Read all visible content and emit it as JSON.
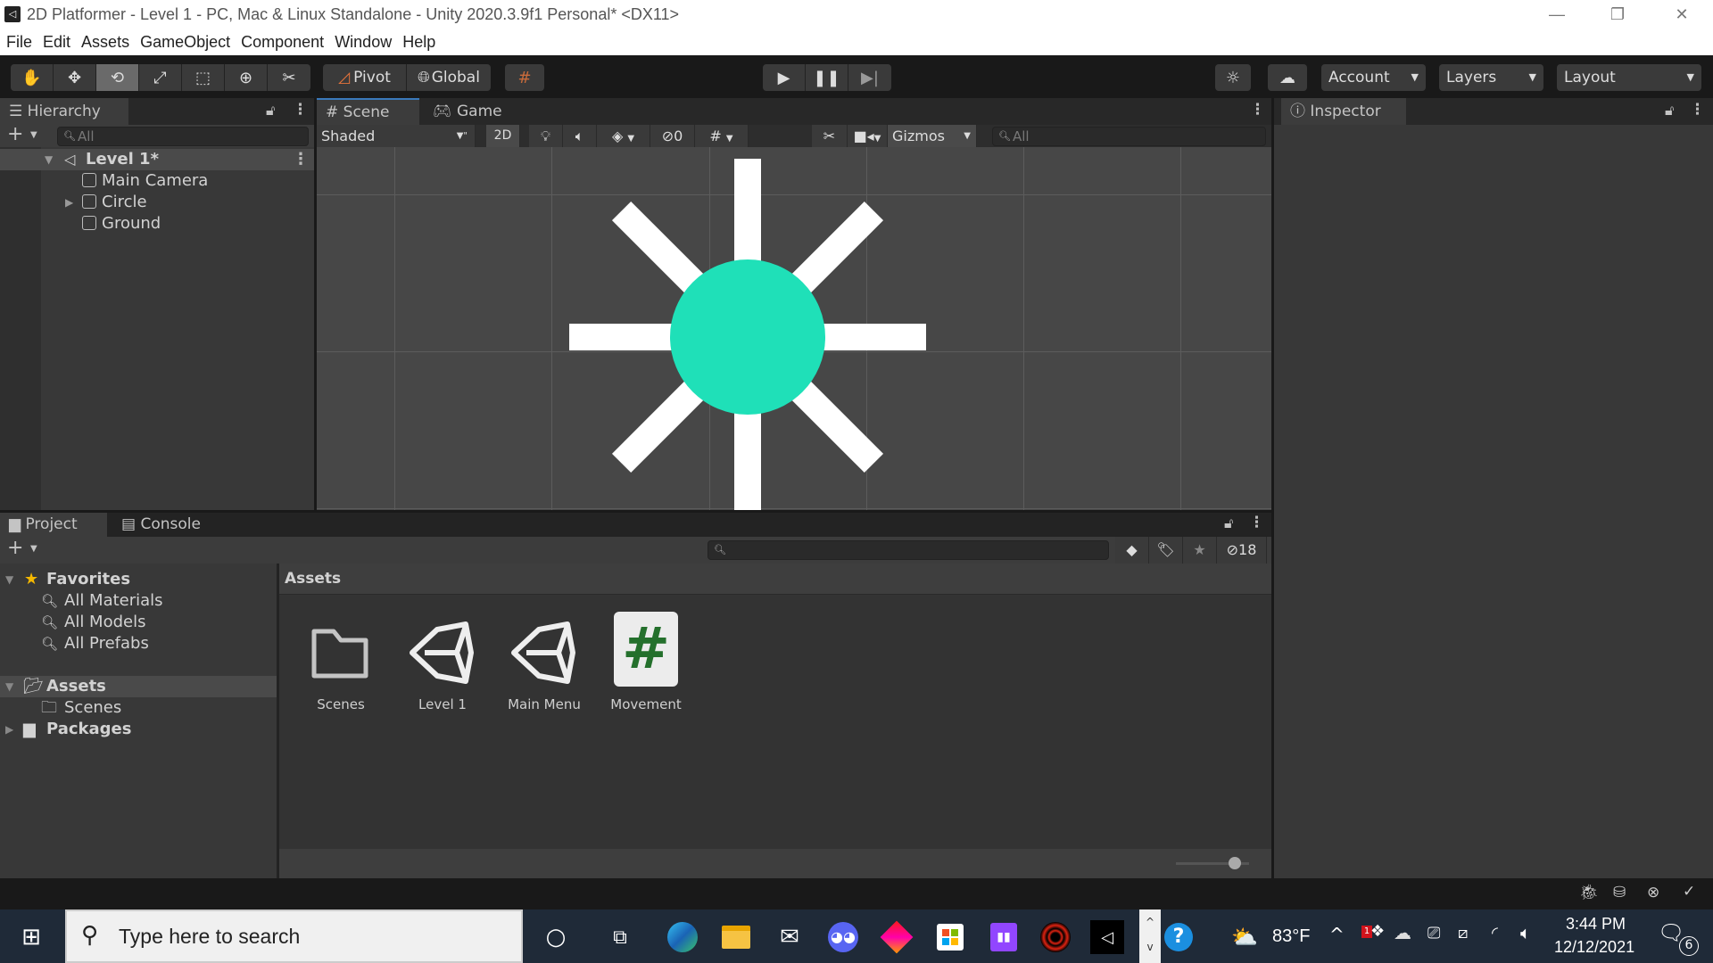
{
  "window": {
    "title": "2D Platformer - Level 1 - PC, Mac & Linux Standalone - Unity 2020.3.9f1 Personal* <DX11>",
    "controls": [
      "minimize",
      "restore",
      "close"
    ]
  },
  "menu": [
    "File",
    "Edit",
    "Assets",
    "GameObject",
    "Component",
    "Window",
    "Help"
  ],
  "toolbar": {
    "tools": [
      "hand-tool",
      "move-tool",
      "rotate-tool",
      "scale-tool",
      "rect-tool",
      "transform-tool",
      "custom-tool"
    ],
    "active_tool": "rotate-tool",
    "pivot_label": "Pivot",
    "global_label": "Global",
    "play_controls": [
      "play",
      "pause",
      "step"
    ],
    "account_label": "Account",
    "layers_label": "Layers",
    "layout_label": "Layout"
  },
  "hierarchy": {
    "tab_label": "Hierarchy",
    "search_placeholder": "All",
    "scene_name": "Level 1*",
    "items": [
      {
        "label": "Main Camera",
        "expandable": false
      },
      {
        "label": "Circle",
        "expandable": true
      },
      {
        "label": "Ground",
        "expandable": false
      }
    ]
  },
  "scene": {
    "tabs": [
      {
        "label": "Scene",
        "icon": "#",
        "active": true
      },
      {
        "label": "Game",
        "icon": "gamepad",
        "active": false
      }
    ],
    "shading_mode": "Shaded",
    "mode_2d_label": "2D",
    "hidden_count": "0",
    "gizmos_label": "Gizmos",
    "search_placeholder": "All",
    "objects": {
      "circle_color": "#1fe0b8",
      "ray_color": "#ffffff",
      "ray_count": 8
    }
  },
  "inspector": {
    "tab_label": "Inspector"
  },
  "project": {
    "tabs": [
      {
        "label": "Project",
        "active": true
      },
      {
        "label": "Console",
        "active": false
      }
    ],
    "hidden_count": "18",
    "favorites": {
      "label": "Favorites",
      "items": [
        "All Materials",
        "All Models",
        "All Prefabs"
      ]
    },
    "tree": [
      {
        "label": "Assets",
        "expanded": true,
        "selected": true
      },
      {
        "label": "Scenes",
        "child": true
      },
      {
        "label": "Packages",
        "expanded": false
      }
    ],
    "breadcrumb": "Assets",
    "assets": [
      {
        "label": "Scenes",
        "type": "folder"
      },
      {
        "label": "Level 1",
        "type": "unity-scene"
      },
      {
        "label": "Main Menu",
        "type": "unity-scene"
      },
      {
        "label": "Movement",
        "type": "csharp-script"
      }
    ],
    "zoom_slider_value": 0.8
  },
  "taskbar": {
    "search_placeholder": "Type here to search",
    "apps": [
      "cortana",
      "task-view",
      "edge",
      "file-explorer",
      "mail",
      "discord",
      "app-red-diamond",
      "microsoft-store",
      "twitch",
      "app-spiral-101",
      "unity"
    ],
    "weather": "83°F",
    "time": "3:44 PM",
    "date": "12/12/2021",
    "notifications": "6",
    "dropbox_badge": "1"
  }
}
